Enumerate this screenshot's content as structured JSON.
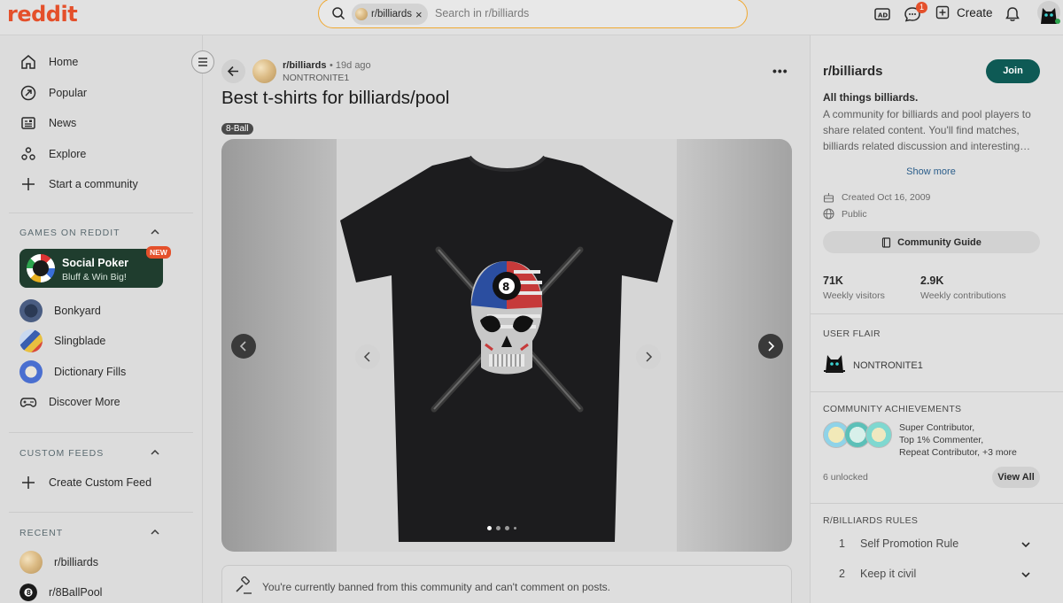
{
  "header": {
    "logo": "reddit",
    "search_chip": "r/billiards",
    "search_placeholder": "Search in r/billiards",
    "chat_badge": "1",
    "create_label": "Create"
  },
  "sidebar": {
    "nav": [
      {
        "label": "Home",
        "icon": "home-icon"
      },
      {
        "label": "Popular",
        "icon": "popular-icon"
      },
      {
        "label": "News",
        "icon": "news-icon"
      },
      {
        "label": "Explore",
        "icon": "explore-icon"
      },
      {
        "label": "Start a community",
        "icon": "plus-icon"
      }
    ],
    "games_title": "GAMES ON REDDIT",
    "poker": {
      "title": "Social Poker",
      "subtitle": "Bluff & Win Big!",
      "badge": "NEW"
    },
    "games": [
      "Bonkyard",
      "Slingblade",
      "Dictionary Fills",
      "Discover More"
    ],
    "custom_feeds_title": "CUSTOM FEEDS",
    "create_feed": "Create Custom Feed",
    "recent_title": "RECENT",
    "recent": [
      "r/billiards",
      "r/8BallPool"
    ]
  },
  "post": {
    "subreddit": "r/billiards",
    "time": "• 19d ago",
    "author": "NONTRONITE1",
    "title": "Best t-shirts for billiards/pool",
    "flair": "8-Ball",
    "image_count": 4,
    "current_image": 1,
    "banned_message": "You're currently banned from this community and can't comment on posts."
  },
  "community": {
    "name": "r/billiards",
    "join_label": "Join",
    "tagline": "All things billiards.",
    "description": "A community for billiards and pool players to share related content. You'll find matches, billiards related discussion and interesting…",
    "show_more": "Show more",
    "created": "Created Oct 16, 2009",
    "visibility": "Public",
    "guide_label": "Community Guide",
    "weekly_visitors": "71K",
    "weekly_visitors_label": "Weekly visitors",
    "weekly_contributions": "2.9K",
    "weekly_contributions_label": "Weekly contributions",
    "user_flair_title": "USER FLAIR",
    "user_flair_name": "NONTRONITE1",
    "achievements_title": "COMMUNITY ACHIEVEMENTS",
    "achievements_lines": [
      "Super Contributor,",
      "Top 1% Commenter,",
      "Repeat Contributor, +3 more"
    ],
    "unlocked": "6 unlocked",
    "view_all": "View All",
    "rules_title": "R/BILLIARDS RULES",
    "rules": [
      {
        "n": "1",
        "label": "Self Promotion Rule"
      },
      {
        "n": "2",
        "label": "Keep it civil"
      }
    ]
  },
  "colors": {
    "brand": "#e4502b",
    "join": "#0e5a55",
    "poker_bg": "#1f3d2e"
  }
}
